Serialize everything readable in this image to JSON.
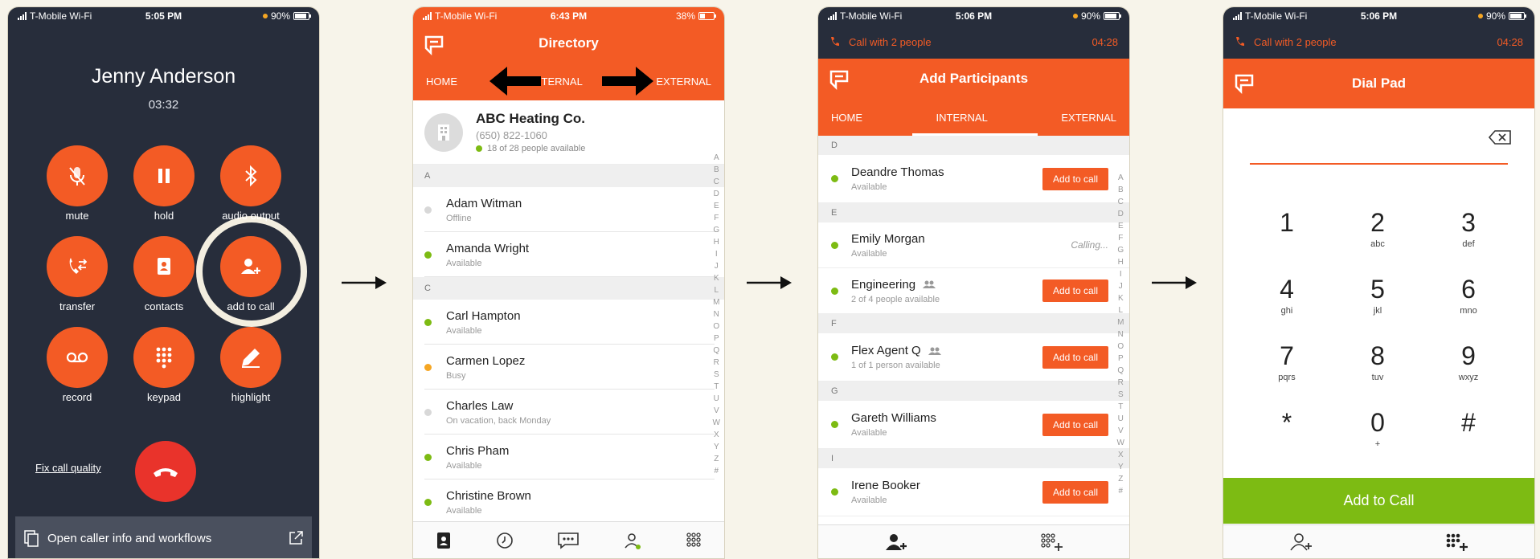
{
  "colors": {
    "accent": "#f35b25",
    "dark": "#272d3b",
    "available": "#7dbb13",
    "busy": "#f5a623",
    "offline": "#d8d8d8",
    "green_button": "#7dbb13"
  },
  "screen1": {
    "status": {
      "carrier": "T-Mobile Wi-Fi",
      "time": "5:05 PM",
      "battery": "90%"
    },
    "caller_name": "Jenny Anderson",
    "timer": "03:32",
    "buttons": [
      {
        "label": "mute",
        "icon": "mic-off-icon"
      },
      {
        "label": "hold",
        "icon": "pause-icon"
      },
      {
        "label": "audio output",
        "icon": "bluetooth-icon"
      },
      {
        "label": "transfer",
        "icon": "transfer-icon"
      },
      {
        "label": "contacts",
        "icon": "contacts-icon"
      },
      {
        "label": "add to call",
        "icon": "add-person-icon"
      },
      {
        "label": "record",
        "icon": "voicemail-icon"
      },
      {
        "label": "keypad",
        "icon": "keypad-icon"
      },
      {
        "label": "highlight",
        "icon": "pen-icon"
      }
    ],
    "fix_quality": "Fix call quality",
    "caller_info": "Open caller info and workflows"
  },
  "screen2": {
    "status": {
      "carrier": "T-Mobile Wi-Fi",
      "time": "6:43 PM",
      "battery": "38%"
    },
    "title": "Directory",
    "tabs": [
      "HOME",
      "INTERNAL",
      "EXTERNAL"
    ],
    "org": {
      "name": "ABC Heating Co.",
      "phone": "(650) 822-1060",
      "availability": "18 of 28 people available"
    },
    "sections": [
      {
        "letter": "A",
        "people": [
          {
            "name": "Adam Witman",
            "status": "Offline",
            "state": "offline"
          },
          {
            "name": "Amanda Wright",
            "status": "Available",
            "state": "available"
          }
        ]
      },
      {
        "letter": "C",
        "people": [
          {
            "name": "Carl Hampton",
            "status": "Available",
            "state": "available"
          },
          {
            "name": "Carmen Lopez",
            "status": "Busy",
            "state": "busy"
          },
          {
            "name": "Charles Law",
            "status": "On vacation, back Monday",
            "state": "offline"
          },
          {
            "name": "Chris Pham",
            "status": "Available",
            "state": "available"
          },
          {
            "name": "Christine Brown",
            "status": "Available",
            "state": "available"
          }
        ]
      }
    ],
    "alphabet": [
      "A",
      "B",
      "C",
      "D",
      "E",
      "F",
      "G",
      "H",
      "I",
      "J",
      "K",
      "L",
      "M",
      "N",
      "O",
      "P",
      "Q",
      "R",
      "S",
      "T",
      "U",
      "V",
      "W",
      "X",
      "Y",
      "Z",
      "#"
    ]
  },
  "screen3": {
    "status": {
      "carrier": "T-Mobile Wi-Fi",
      "time": "5:06 PM",
      "battery": "90%"
    },
    "callbar": {
      "text": "Call with 2 people",
      "timer": "04:28"
    },
    "title": "Add Participants",
    "tabs": [
      "HOME",
      "INTERNAL",
      "EXTERNAL"
    ],
    "add_label": "Add to call",
    "calling_label": "Calling...",
    "sections": [
      {
        "letter": "D",
        "people": [
          {
            "name": "Deandre Thomas",
            "status": "Available",
            "action": "add",
            "group": false
          }
        ]
      },
      {
        "letter": "E",
        "people": [
          {
            "name": "Emily Morgan",
            "status": "Available",
            "action": "calling",
            "group": false
          },
          {
            "name": "Engineering",
            "status": "2 of 4 people available",
            "action": "add",
            "group": true
          }
        ]
      },
      {
        "letter": "F",
        "people": [
          {
            "name": "Flex Agent Q",
            "status": "1 of 1 person available",
            "action": "add",
            "group": true
          }
        ]
      },
      {
        "letter": "G",
        "people": [
          {
            "name": "Gareth Williams",
            "status": "Available",
            "action": "add",
            "group": false
          }
        ]
      },
      {
        "letter": "I",
        "people": [
          {
            "name": "Irene Booker",
            "status": "Available",
            "action": "add",
            "group": false
          }
        ]
      }
    ],
    "alphabet": [
      "A",
      "B",
      "C",
      "D",
      "E",
      "F",
      "G",
      "H",
      "I",
      "J",
      "K",
      "L",
      "M",
      "N",
      "O",
      "P",
      "Q",
      "R",
      "S",
      "T",
      "U",
      "V",
      "W",
      "X",
      "Y",
      "Z",
      "#"
    ]
  },
  "screen4": {
    "status": {
      "carrier": "T-Mobile Wi-Fi",
      "time": "5:06 PM",
      "battery": "90%"
    },
    "callbar": {
      "text": "Call with 2 people",
      "timer": "04:28"
    },
    "title": "Dial Pad",
    "keys": [
      {
        "d": "1",
        "s": ""
      },
      {
        "d": "2",
        "s": "abc"
      },
      {
        "d": "3",
        "s": "def"
      },
      {
        "d": "4",
        "s": "ghi"
      },
      {
        "d": "5",
        "s": "jkl"
      },
      {
        "d": "6",
        "s": "mno"
      },
      {
        "d": "7",
        "s": "pqrs"
      },
      {
        "d": "8",
        "s": "tuv"
      },
      {
        "d": "9",
        "s": "wxyz"
      },
      {
        "d": "*",
        "s": ""
      },
      {
        "d": "0",
        "s": "+"
      },
      {
        "d": "#",
        "s": ""
      }
    ],
    "add_button": "Add to Call"
  }
}
